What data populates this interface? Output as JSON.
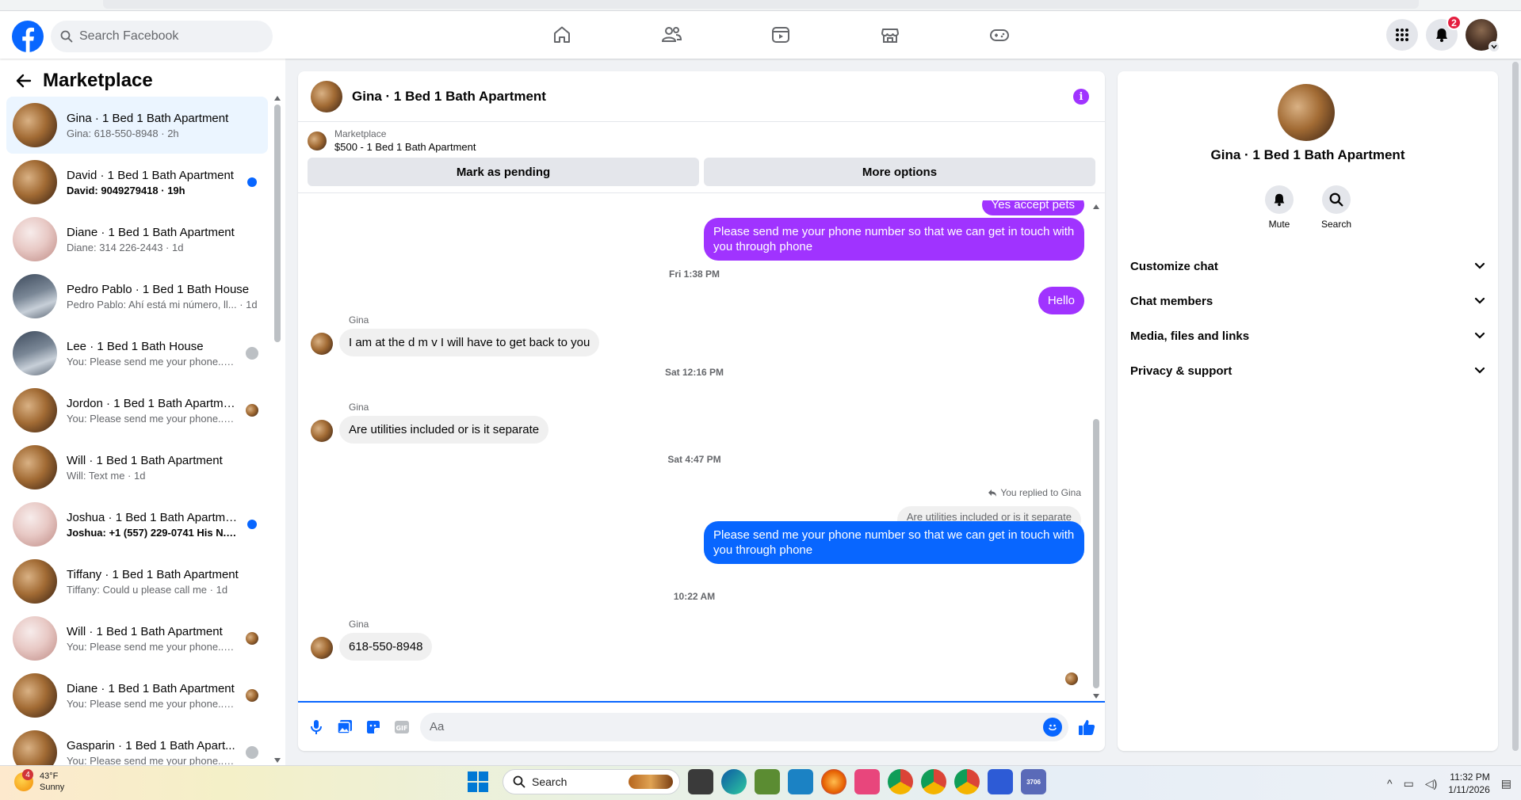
{
  "topbar": {
    "search_placeholder": "Search Facebook",
    "notification_count": "2"
  },
  "sidebar": {
    "title": "Marketplace",
    "conversations": [
      {
        "title": "Gina · 1 Bed 1 Bath Apartment",
        "preview": "Gina: 618-550-8948 · 2h",
        "thumb": "wood",
        "active": true,
        "unread": false,
        "indicator": "none"
      },
      {
        "title": "David · 1 Bed 1 Bath Apartment",
        "preview": "David: 9049279418 · 19h",
        "thumb": "wood",
        "active": false,
        "unread": true,
        "indicator": "dot"
      },
      {
        "title": "Diane · 1 Bed 1 Bath Apartment",
        "preview": "Diane: 314 226-2443 · 1d",
        "thumb": "pink",
        "active": false,
        "unread": false,
        "indicator": "none"
      },
      {
        "title": "Pedro Pablo · 1 Bed 1 Bath House",
        "preview": "Pedro Pablo: Ahí está mi número, ll... · 1d",
        "thumb": "gray",
        "active": false,
        "unread": false,
        "indicator": "none"
      },
      {
        "title": "Lee · 1 Bed 1 Bath House",
        "preview": "You: Please send me your phone... 1d",
        "thumb": "gray",
        "active": false,
        "unread": false,
        "indicator": "anon"
      },
      {
        "title": "Jordon · 1 Bed 1 Bath Apartme...",
        "preview": "You: Please send me your phone... 1d",
        "thumb": "wood",
        "active": false,
        "unread": false,
        "indicator": "seen"
      },
      {
        "title": "Will · 1 Bed 1 Bath Apartment",
        "preview": "Will: Text me · 1d",
        "thumb": "wood",
        "active": false,
        "unread": false,
        "indicator": "none"
      },
      {
        "title": "Joshua · 1 Bed 1 Bath Apartment",
        "preview": "Joshua: +1 (557) 229-0741 His N... 1d",
        "thumb": "pink",
        "active": false,
        "unread": true,
        "indicator": "dot"
      },
      {
        "title": "Tiffany · 1 Bed 1 Bath Apartment",
        "preview": "Tiffany: Could u please call me · 1d",
        "thumb": "wood",
        "active": false,
        "unread": false,
        "indicator": "none"
      },
      {
        "title": "Will · 1 Bed 1 Bath Apartment",
        "preview": "You: Please send me your phone... 1d",
        "thumb": "pink",
        "active": false,
        "unread": false,
        "indicator": "seen"
      },
      {
        "title": "Diane · 1 Bed 1 Bath Apartment",
        "preview": "You: Please send me your phone... 1d",
        "thumb": "wood",
        "active": false,
        "unread": false,
        "indicator": "seen"
      },
      {
        "title": "Gasparin · 1 Bed 1 Bath Apart...",
        "preview": "You: Please send me your phone... 1d",
        "thumb": "wood",
        "active": false,
        "unread": false,
        "indicator": "anon"
      }
    ]
  },
  "chat": {
    "title": "Gina · 1 Bed 1 Bath Apartment",
    "marketplace_label": "Marketplace",
    "listing": "$500 - 1 Bed 1 Bath Apartment",
    "mark_pending": "Mark as pending",
    "more_options": "More options",
    "partial_top_message": "Yes accept  pets",
    "msg1": "Please send me your phone  number so that we can get in touch with you through phone",
    "ts1": "Fri 1:38 PM",
    "msg2": "Hello",
    "sender": "Gina",
    "msg3": "I am at the d m v I will have to get back to you",
    "ts2": "Sat 12:16 PM",
    "msg4": "Are utilities included or is it separate",
    "ts3": "Sat 4:47 PM",
    "reply_note": "You replied to Gina",
    "quoted": "Are utilities included or is it separate",
    "msg5": "Please send me your phone  number so that we can get in touch with you through phone",
    "ts4": "10:22 AM",
    "msg6": "618-550-8948",
    "composer_placeholder": "Aa"
  },
  "details": {
    "title": "Gina · 1 Bed 1 Bath Apartment",
    "mute": "Mute",
    "search": "Search",
    "sections": [
      "Customize chat",
      "Chat members",
      "Media, files and links",
      "Privacy & support"
    ]
  },
  "taskbar": {
    "weather_badge": "4",
    "temp": "43°F",
    "condition": "Sunny",
    "search": "Search",
    "time": "11:32 PM",
    "date": "1/11/2026",
    "app_badge": "3706"
  },
  "colors": {
    "accent_purple": "#a033ff",
    "fb_blue": "#0866ff",
    "unread_dot": "#0866ff"
  }
}
